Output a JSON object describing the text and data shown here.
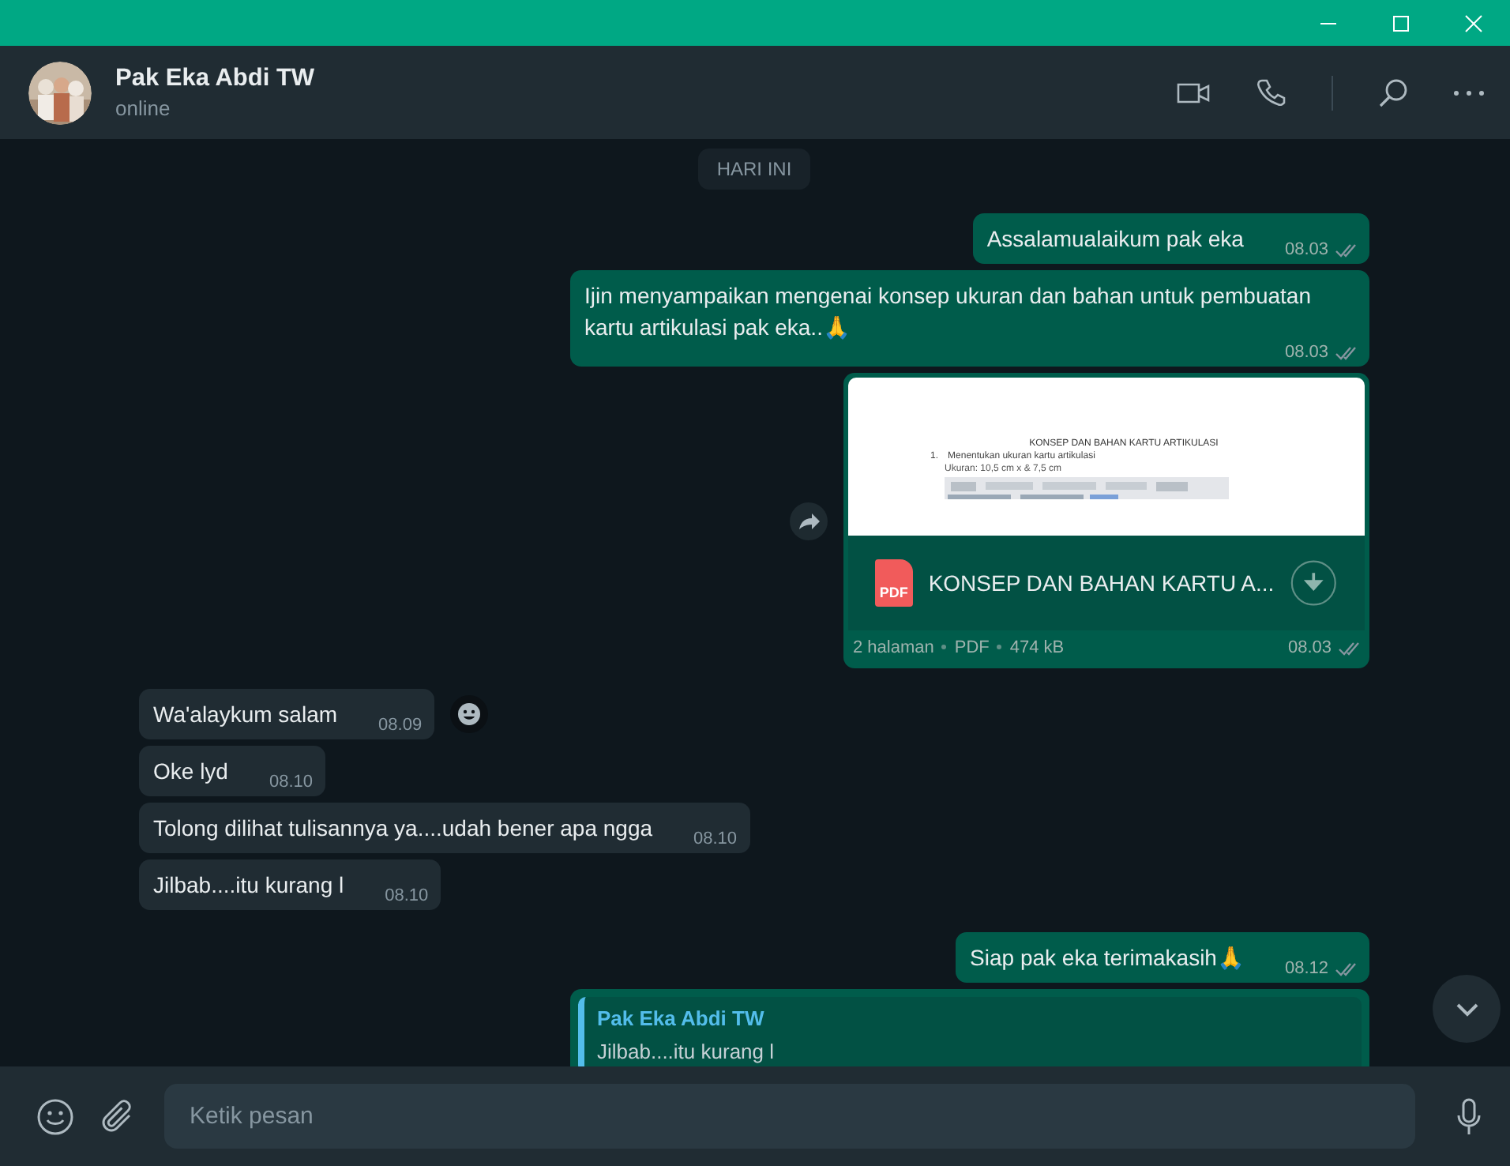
{
  "contact": {
    "name": "Pak Eka Abdi TW",
    "status": "online"
  },
  "messages": [
    {
      "kind": "date",
      "text": "HARI INI"
    },
    {
      "kind": "text",
      "outgoing": true,
      "text": "Assalamualaikum pak eka",
      "time": "08.03"
    },
    {
      "kind": "text",
      "outgoing": true,
      "text": "Ijin menyampaikan mengenai konsep ukuran dan bahan untuk pembuatan kartu artikulasi pak eka..🙏",
      "time": "08.03"
    },
    {
      "kind": "document",
      "outgoing": true,
      "forward_button": true,
      "preview_title": "KONSEP DAN BAHAN KARTU ARTIKULASI",
      "preview_number": "1.",
      "preview_heading": "Menentukan ukuran kartu artikulasi",
      "preview_line": "Ukuran: 10,5 cm x & 7,5 cm",
      "file_icon": "PDF",
      "file_name": "KONSEP DAN BAHAN KARTU A...",
      "pages": "2 halaman",
      "file_type": "PDF",
      "size": "474 kB",
      "time": "08.03"
    },
    {
      "kind": "text",
      "outgoing": false,
      "react_button": true,
      "text": "Wa'alaykum salam",
      "time": "08.09"
    },
    {
      "kind": "text",
      "outgoing": false,
      "text": "Oke lyd",
      "time": "08.10"
    },
    {
      "kind": "text",
      "outgoing": false,
      "text": "Tolong dilihat tulisannya ya....udah bener apa ngga",
      "time": "08.10"
    },
    {
      "kind": "text",
      "outgoing": false,
      "text": "Jilbab....itu kurang l",
      "time": "08.10"
    },
    {
      "kind": "text",
      "outgoing": true,
      "text": "Siap pak eka terimakasih🙏",
      "time": "08.12"
    },
    {
      "kind": "reply",
      "outgoing": true,
      "quote_author": "Pak Eka Abdi TW",
      "quote_text": "Jilbab....itu kurang l"
    }
  ],
  "composer": {
    "placeholder": "Ketik pesan"
  }
}
